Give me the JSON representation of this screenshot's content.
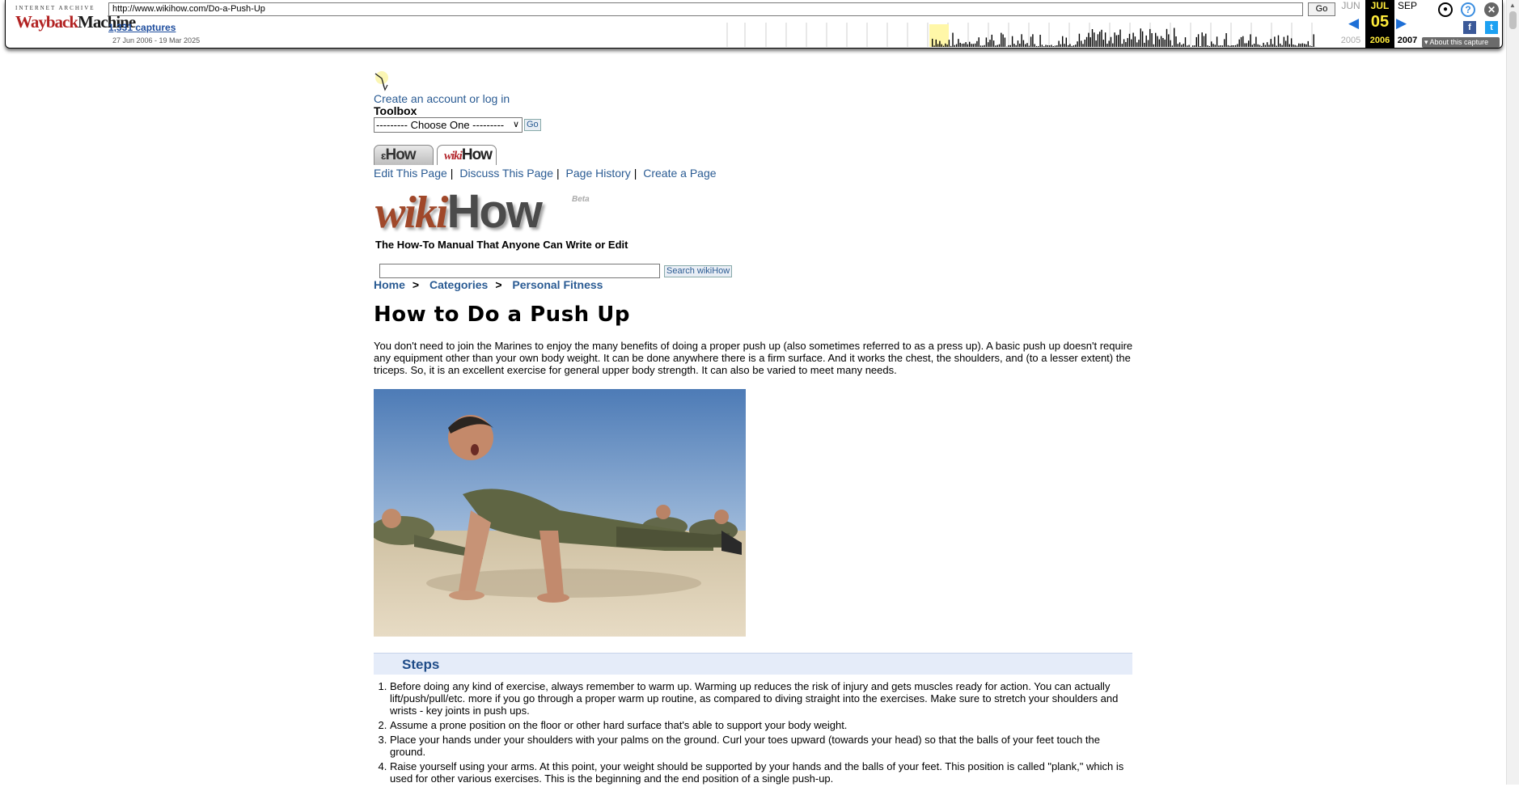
{
  "wayback": {
    "logo_small": "INTERNET ARCHIVE",
    "logo_way": "Wayback",
    "logo_machine": "Machine",
    "url": "http://www.wikihow.com/Do-a-Push-Up",
    "go_label": "Go",
    "captures": "1,331 captures",
    "date_range": "27 Jun 2006 - 19 Mar 2025",
    "prev_month": "JUN",
    "cur_month": "JUL",
    "next_month": "SEP",
    "cur_day": "05",
    "prev_year": "2005",
    "cur_year": "2006",
    "next_year": "2007",
    "about_label": "About this capture"
  },
  "toolbar": {
    "login_link": "Create an account or log in",
    "toolbox_label": "Toolbox",
    "toolbox_select": "--------- Choose One ---------",
    "toolbox_go": "Go"
  },
  "tabs": {
    "ehow_label": "How",
    "wikihow_prefix": "wiki",
    "wikihow_suffix": "How"
  },
  "page_actions": [
    "Edit This Page",
    "Discuss This Page",
    "Page History",
    "Create a Page"
  ],
  "logo": {
    "wiki": "wiki",
    "how": "How",
    "beta": "Beta",
    "tagline": "The How-To Manual That Anyone Can Write or Edit"
  },
  "search": {
    "value": "",
    "button": "Search wikiHow"
  },
  "breadcrumb": [
    "Home",
    "Categories",
    "Personal Fitness"
  ],
  "breadcrumb_sep": ">",
  "article": {
    "title": "How to Do a Push Up",
    "intro": "You don't need to join the Marines to enjoy the many benefits of doing a proper push up (also sometimes referred to as a press up). A basic push up doesn't require any equipment other than your own body weight. It can be done anywhere there is a firm surface. And it works the chest, the shoulders, and (to a lesser extent) the triceps. So, it is an excellent exercise for general upper body strength. It can also be varied to meet many needs.",
    "steps_title": "Steps",
    "steps": [
      "Before doing any kind of exercise, always remember to warm up. Warming up reduces the risk of injury and gets muscles ready for action. You can actually lift/push/pull/etc. more if you go through a proper warm up routine, as compared to diving straight into the exercises. Make sure to stretch your shoulders and wrists - key joints in push ups.",
      "Assume a prone position on the floor or other hard surface that's able to support your body weight.",
      "Place your hands under your shoulders with your palms on the ground. Curl your toes upward (towards your head) so that the balls of your feet touch the ground.",
      "Raise yourself using your arms. At this point, your weight should be supported by your hands and the balls of your feet. This position is called \"plank,\" which is used for other various exercises. This is the beginning and the end position of a single push-up."
    ]
  },
  "colors": {
    "link": "#2a5b93",
    "steps_header_bg": "#e5ecf9",
    "wayback_highlight": "#ffeb3b"
  }
}
